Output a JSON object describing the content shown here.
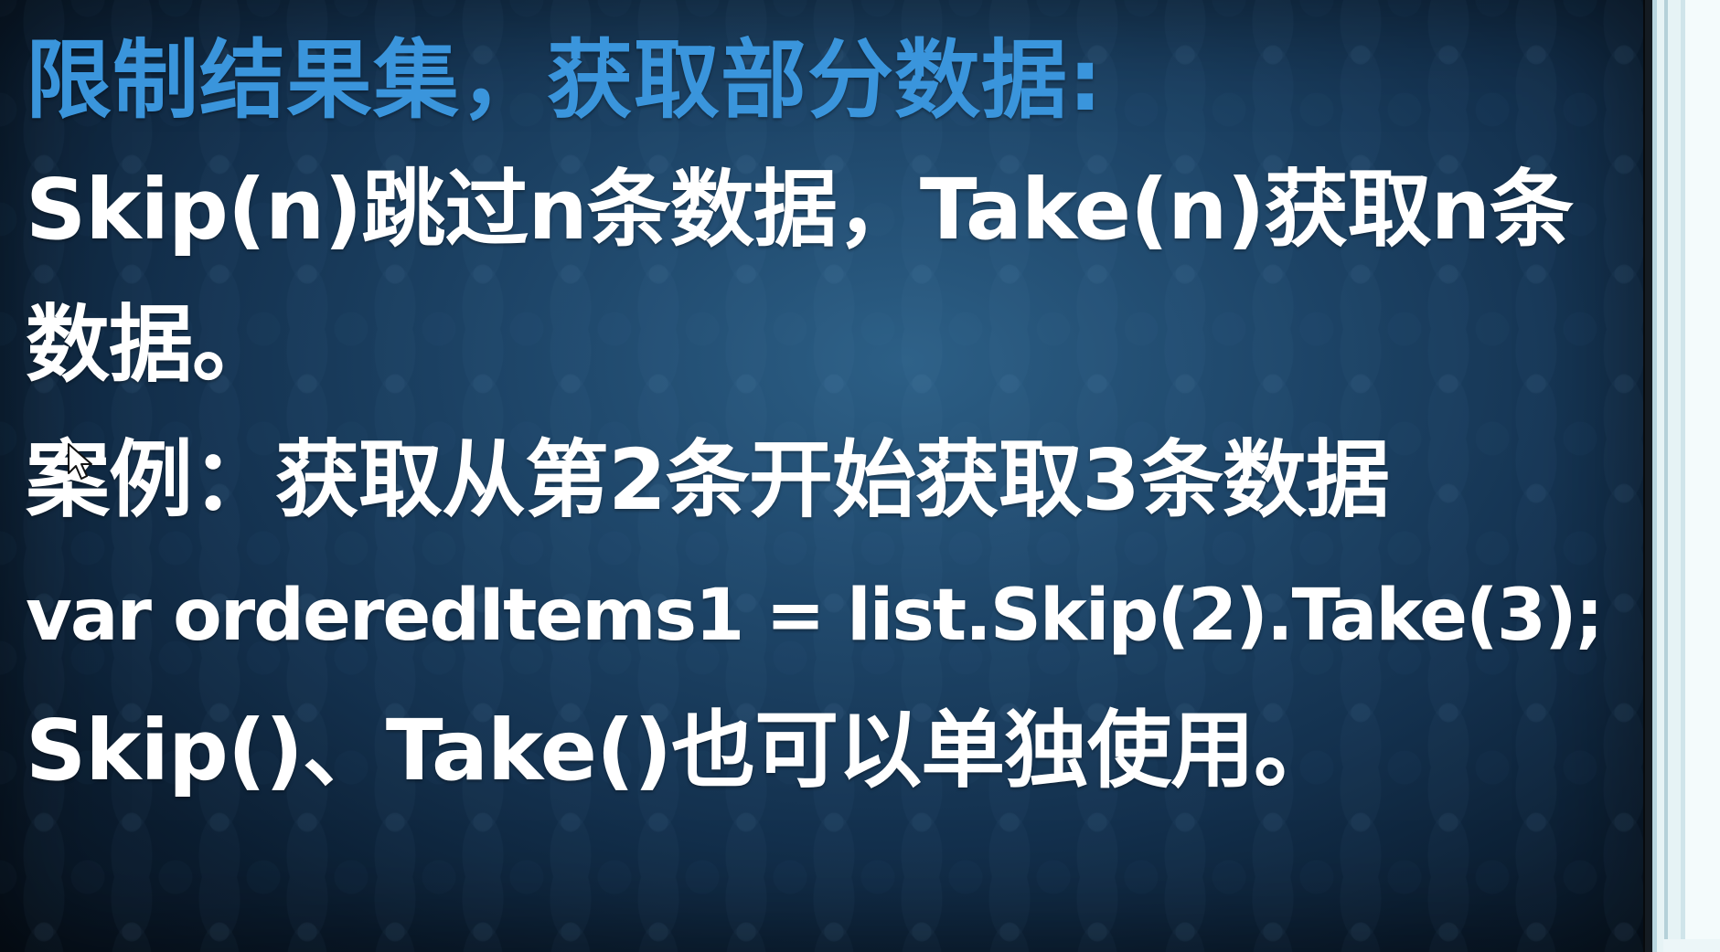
{
  "slide": {
    "title": "限制结果集，获取部分数据:",
    "line_1": "Skip(n)跳过n条数据，Take(n)获取n条",
    "line_2": "数据。",
    "line_3": "案例：获取从第2条开始获取3条数据",
    "line_4": "var orderedItems1 = list.Skip(2).Take(3);",
    "line_5": "Skip()、Take()也可以单独使用。"
  },
  "icons": {
    "cursor": "mouse-pointer-icon"
  },
  "colors": {
    "title": "#3a95dc",
    "body_text": "#ffffff",
    "slide_background": "#1d4467",
    "side_panel": "#e6f3f5"
  }
}
